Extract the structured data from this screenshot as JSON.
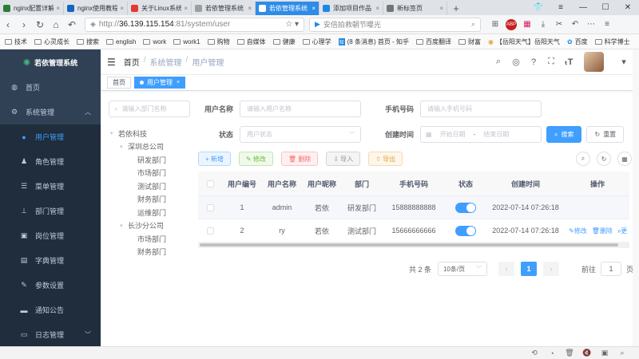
{
  "browser": {
    "tabs": [
      {
        "label": "nginx配置详解",
        "color": "#2e7d32"
      },
      {
        "label": "nginx使用教程",
        "color": "#1565c0"
      },
      {
        "label": "关于Linux系统",
        "color": "#e53935"
      },
      {
        "label": "若依管理系统",
        "color": "#9e9e9e"
      },
      {
        "label": "若依管理系统",
        "color": "#ffffff"
      },
      {
        "label": "添加项目作品",
        "color": "#1e88e5"
      },
      {
        "label": "新标签页",
        "color": "#757575"
      }
    ],
    "new_tab": "+",
    "url_host": "36.139.115.154",
    "url_rest": ":81/system/user",
    "url_prefix": "http://",
    "search_text": "安倍拍救朝节曝光",
    "bookmarks": [
      "技术",
      "心灵成长",
      "搜索",
      "english",
      "work",
      "work1",
      "购物",
      "自媒体",
      "健康",
      "心理学",
      "(8 条消息) 首页 - 知乎",
      "百度翻译",
      "财富",
      "【岳阳天气】岳阳天气",
      "百度",
      "科学博士"
    ]
  },
  "app": {
    "logo_text": "若依管理系统",
    "menu": [
      {
        "label": "首页",
        "icon": "dashboard-icon"
      },
      {
        "label": "系统管理",
        "icon": "gear-icon"
      },
      {
        "label": "用户管理",
        "icon": "user-icon"
      },
      {
        "label": "角色管理",
        "icon": "role-icon"
      },
      {
        "label": "菜单管理",
        "icon": "menu-list-icon"
      },
      {
        "label": "部门管理",
        "icon": "tree-icon"
      },
      {
        "label": "岗位管理",
        "icon": "post-icon"
      },
      {
        "label": "字典管理",
        "icon": "dict-icon"
      },
      {
        "label": "参数设置",
        "icon": "edit-icon"
      },
      {
        "label": "通知公告",
        "icon": "message-icon"
      },
      {
        "label": "日志管理",
        "icon": "log-icon"
      }
    ],
    "breadcrumb": [
      "首页",
      "系统管理",
      "用户管理"
    ],
    "tags": [
      "首页",
      "用户管理"
    ],
    "dept_search_placeholder": "请输入部门名称",
    "tree": [
      {
        "label": "若依科技",
        "level": 0
      },
      {
        "label": "深圳总公司",
        "level": 1
      },
      {
        "label": "研发部门",
        "level": 2
      },
      {
        "label": "市场部门",
        "level": 2
      },
      {
        "label": "测试部门",
        "level": 2
      },
      {
        "label": "财务部门",
        "level": 2
      },
      {
        "label": "运维部门",
        "level": 2
      },
      {
        "label": "长沙分公司",
        "level": 1
      },
      {
        "label": "市场部门",
        "level": 2
      },
      {
        "label": "财务部门",
        "level": 2
      }
    ],
    "form": {
      "username_label": "用户名称",
      "username_placeholder": "请输入用户名称",
      "phone_label": "手机号码",
      "phone_placeholder": "请输入手机号码",
      "status_label": "状态",
      "status_placeholder": "用户状态",
      "time_label": "创建时间",
      "start_placeholder": "开始日期",
      "end_placeholder": "结束日期",
      "range_sep": "-",
      "search_btn": "搜索",
      "reset_btn": "重置"
    },
    "toolbar": {
      "add": "+ 新增",
      "edit": "✎ 修改",
      "delete": "🗑 删除",
      "import": "⇩ 导入",
      "export": "⇧ 导出"
    },
    "table": {
      "headers": [
        "用户编号",
        "用户名称",
        "用户昵称",
        "部门",
        "手机号码",
        "状态",
        "创建时间",
        "操作"
      ],
      "rows": [
        {
          "id": "1",
          "username": "admin",
          "nickname": "若依",
          "dept": "研发部门",
          "phone": "15888888888",
          "status": true,
          "created": "2022-07-14 07:26:18",
          "ops": []
        },
        {
          "id": "2",
          "username": "ry",
          "nickname": "若依",
          "dept": "测试部门",
          "phone": "15666666666",
          "status": true,
          "created": "2022-07-14 07:26:18",
          "ops": [
            "✎修改",
            "🗑删除",
            "»更"
          ]
        }
      ]
    },
    "pager": {
      "total": "共 2 条",
      "page_size": "10条/页",
      "current": "1",
      "goto_label": "前往",
      "goto_value": "1",
      "page_unit": "页"
    }
  }
}
